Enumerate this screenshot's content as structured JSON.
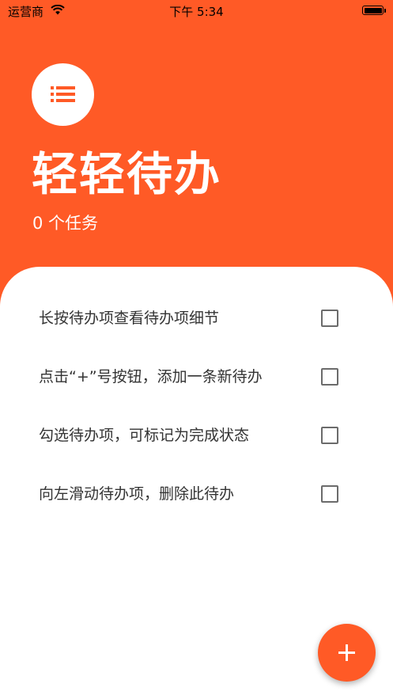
{
  "status_bar": {
    "carrier": "运营商",
    "time": "下午 5:34"
  },
  "header": {
    "title": "轻轻待办",
    "count": "0 个任务",
    "icon": "list-icon"
  },
  "todos": [
    {
      "text": "长按待办项查看待办项细节",
      "checked": false
    },
    {
      "text": "点击“+”号按钮，添加一条新待办",
      "checked": false
    },
    {
      "text": "勾选待办项，可标记为完成状态",
      "checked": false
    },
    {
      "text": "向左滑动待办项，删除此待办",
      "checked": false
    }
  ],
  "fab": {
    "icon": "plus-icon"
  },
  "colors": {
    "accent": "#FF5A26",
    "background": "#FFFFFF",
    "text": "#333333"
  }
}
